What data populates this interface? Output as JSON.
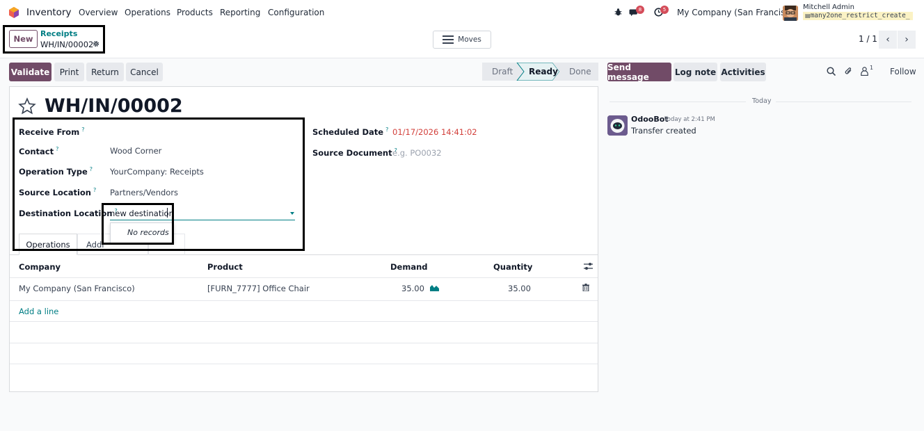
{
  "navbar": {
    "app_name": "Inventory",
    "menu": [
      "Overview",
      "Operations",
      "Products",
      "Reporting",
      "Configuration"
    ],
    "messages_badge": "8",
    "activities_badge": "5",
    "company": "My Company (San Francisco)",
    "user_name": "Mitchell Admin",
    "db_name": "many2one_restrict_create_"
  },
  "control_panel": {
    "new_label": "New",
    "breadcrumb_parent": "Receipts",
    "breadcrumb_current": "WH/IN/00002",
    "moves_label": "Moves",
    "pager": "1 / 1"
  },
  "actions": {
    "validate": "Validate",
    "print": "Print",
    "return": "Return",
    "cancel": "Cancel"
  },
  "status": {
    "stages": [
      "Draft",
      "Ready",
      "Done"
    ],
    "current": "Ready"
  },
  "form": {
    "title": "WH/IN/00002",
    "receive_from_label": "Receive From",
    "contact_label": "Contact",
    "contact_value": "Wood Corner",
    "operation_type_label": "Operation Type",
    "operation_type_value": "YourCompany: Receipts",
    "source_location_label": "Source Location",
    "source_location_value": "Partners/Vendors",
    "destination_location_label": "Destination Location",
    "destination_location_value": "new destination",
    "dropdown_no_records": "No records",
    "scheduled_date_label": "Scheduled Date",
    "scheduled_date_value": "01/17/2026 14:41:02",
    "source_document_label": "Source Document",
    "source_document_placeholder": "e.g. PO0032",
    "help_mark": "?"
  },
  "tabs": [
    "Operations",
    "Addi"
  ],
  "table": {
    "headers": [
      "Company",
      "Product",
      "Demand",
      "Quantity"
    ],
    "rows": [
      {
        "company": "My Company (San Francisco)",
        "product": "[FURN_7777] Office Chair",
        "demand": "35.00",
        "quantity": "35.00"
      }
    ],
    "add_line": "Add a line"
  },
  "chatter": {
    "send_message": "Send message",
    "log_note": "Log note",
    "activities": "Activities",
    "followers_count": "1",
    "follow": "Follow",
    "date_separator": "Today",
    "messages": [
      {
        "author": "OdooBot",
        "time": "Today at 2:41 PM",
        "body": "Transfer created"
      }
    ]
  },
  "colors": {
    "primary": "#714b67",
    "accent": "#017e84",
    "date_warning": "#d23f3a"
  }
}
